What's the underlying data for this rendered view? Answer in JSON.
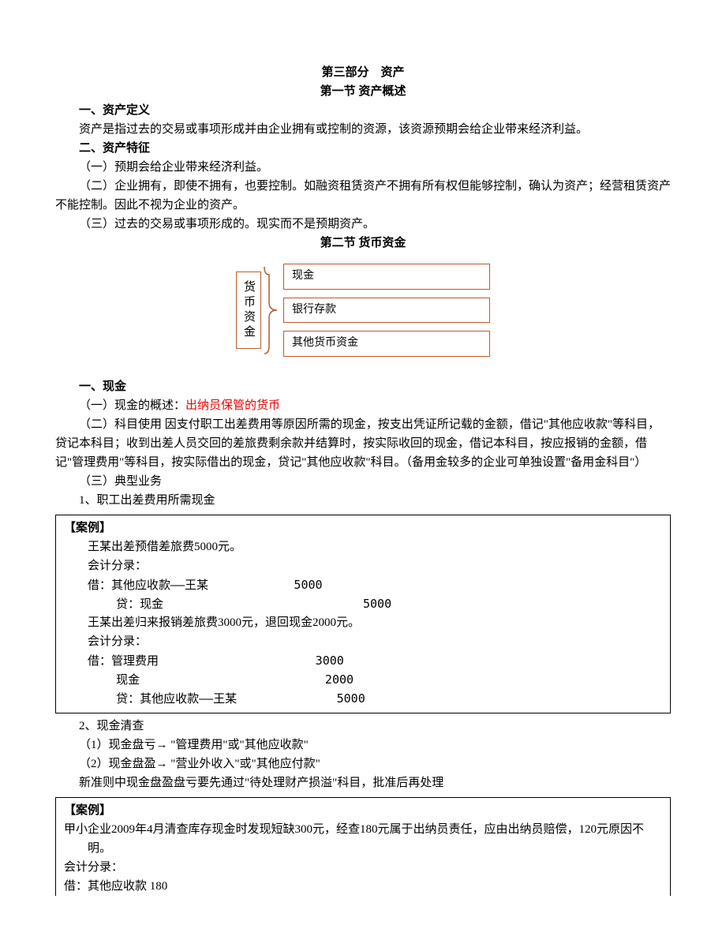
{
  "title_part": "第三部分　资产",
  "section1_title": "第一节 资产概述",
  "h1": "一、资产定义",
  "def_text": "资产是指过去的交易或事项形成并由企业拥有或控制的资源，该资源预期会给企业带来经济利益。",
  "h2": "二、资产特征",
  "feat1": "（一）预期会给企业带来经济利益。",
  "feat2": "（二）企业拥有，即使不拥有，也要控制。如融资租赁资产不拥有所有权但能够控制，确认为资产；经营租赁资产不能控制。因此不视为企业的资产。",
  "feat3": "（三）过去的交易或事项形成的。现实而不是预期资产。",
  "section2_title": "第二节 货币资金",
  "diagram": {
    "root": "货币资金",
    "items": [
      "现金",
      "银行存款",
      "其他货币资金"
    ]
  },
  "cash_h": "一、现金",
  "cash_1a": "（一）现金的概述：",
  "cash_1b": "出纳员保管的货币",
  "cash_2": "（二）科目使用 因支付职工出差费用等原因所需的现金，按支出凭证所记载的金额，借记\"其他应收款\"等科目，贷记本科目；收到出差人员交回的差旅费剩余款并结算时，按实际收回的现金，借记本科目，按应报销的金额，借记\"管理费用\"等科目，按实际借出的现金，贷记\"其他应收款\"科目。（备用金较多的企业可单独设置\"备用金科目\"）",
  "cash_3": "（三）典型业务",
  "biz1": "1、职工出差费用所需现金",
  "case1": {
    "label": "【案例】",
    "l1": "王某出差预借差旅费5000元。",
    "l2": "会计分录：",
    "l3": "借：其他应收款——王某            5000",
    "l4": "    贷：现金                            5000",
    "l5": "王某出差归来报销差旅费3000元，退回现金2000元。",
    "l6": "会计分录：",
    "l7": "借：管理费用                      3000",
    "l8": "    现金                          2000",
    "l9": "    贷：其他应收款——王某              5000"
  },
  "biz2": "2、现金清查",
  "biz2_1": "（1）现金盘亏→ \"管理费用\"或\"其他应收款\"",
  "biz2_2": "（2）现金盘盈→ \"营业外收入\"或\"其他应付款\"",
  "biz2_note": "新准则中现金盘盈盘亏要先通过\"待处理财产损溢\"科目，批准后再处理",
  "case2": {
    "label": "【案例】",
    "l1": "甲小企业2009年4月清查库存现金时发现短缺300元，经查180元属于出纳员责任，应由出纳员赔偿，120元原因不明。",
    "l2": "会计分录：",
    "l3": "借：其他应收款                    180"
  }
}
